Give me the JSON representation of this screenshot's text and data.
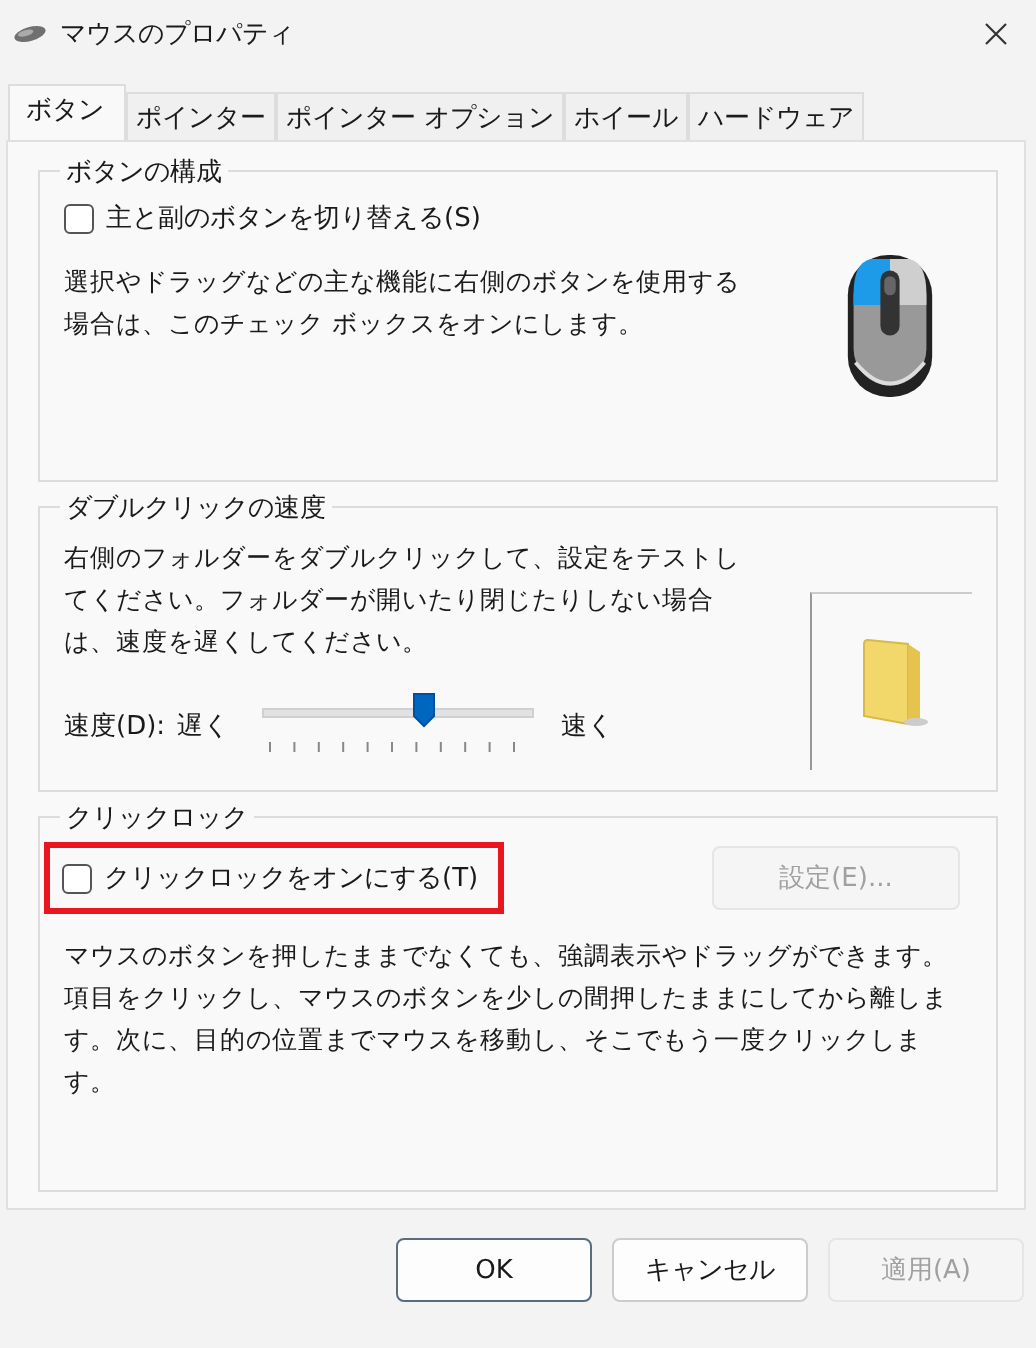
{
  "window": {
    "title": "マウスのプロパティ"
  },
  "tabs": [
    {
      "label": "ボタン",
      "selected": true
    },
    {
      "label": "ポインター",
      "selected": false
    },
    {
      "label": "ポインター オプション",
      "selected": false
    },
    {
      "label": "ホイール",
      "selected": false
    },
    {
      "label": "ハードウェア",
      "selected": false
    }
  ],
  "button_config": {
    "title": "ボタンの構成",
    "checkbox": {
      "label": "主と副のボタンを切り替える(S)",
      "checked": false
    },
    "description": "選択やドラッグなどの主な機能に右側のボタンを使用する場合は、このチェック ボックスをオンにします。"
  },
  "double_click": {
    "title": "ダブルクリックの速度",
    "description": "右側のフォルダーをダブルクリックして、設定をテストしてください。フォルダーが開いたり閉じたりしない場合は、速度を遅くしてください。",
    "speed_label": "速度(D):",
    "slow_label": "遅く",
    "fast_label": "速く",
    "level": 0.6
  },
  "click_lock": {
    "title": "クリックロック",
    "checkbox": {
      "label": "クリックロックをオンにする(T)",
      "checked": false,
      "highlighted": true
    },
    "settings_button": {
      "label": "設定(E)...",
      "disabled": true
    },
    "description": "マウスのボタンを押したままでなくても、強調表示やドラッグができます。項目をクリックし、マウスのボタンを少しの間押したままにしてから離します。次に、目的の位置までマウスを移動し、そこでもう一度クリックします。"
  },
  "buttons": [
    {
      "label": "OK",
      "disabled": false,
      "default": true
    },
    {
      "label": "キャンセル",
      "disabled": false,
      "default": false
    },
    {
      "label": "適用(A)",
      "disabled": true,
      "default": false
    }
  ]
}
